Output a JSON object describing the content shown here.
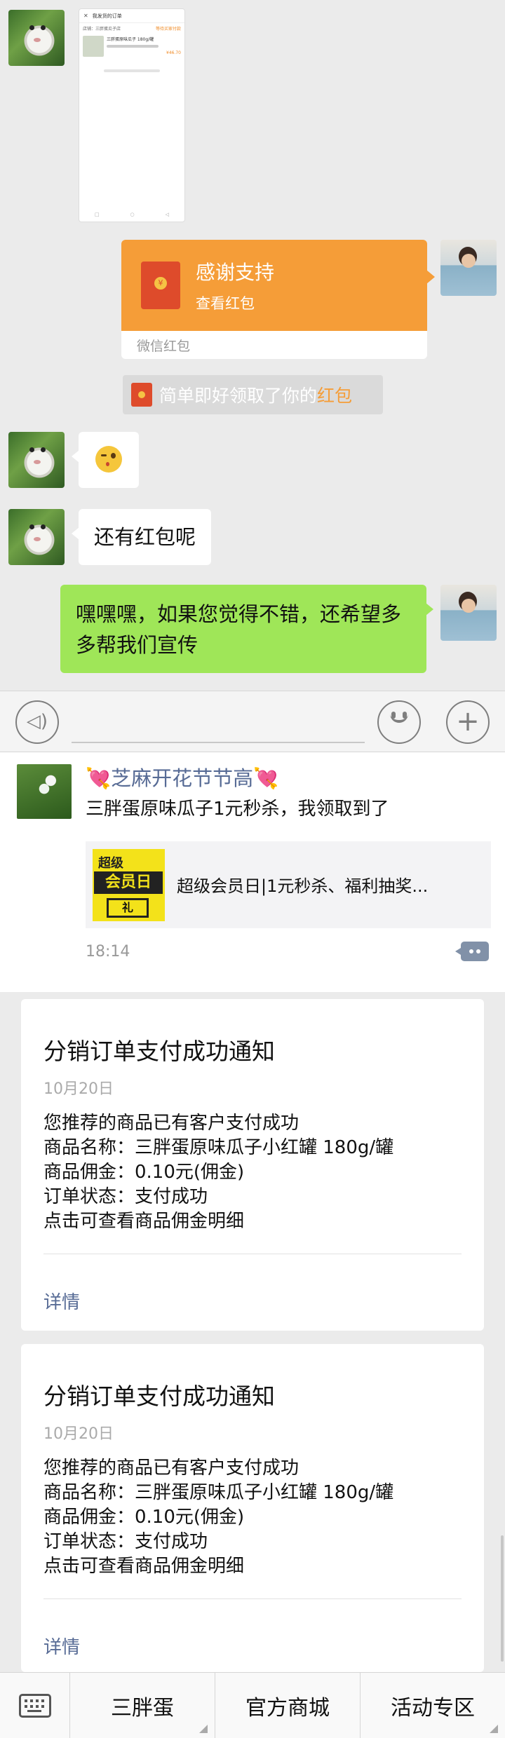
{
  "chat": {
    "screenshot": {
      "title": "我发货的订单",
      "shop": "店铺：三胖蛋瓜子店",
      "status": "等待买家付款",
      "item": "三胖蛋原味瓜子 180g/罐",
      "price": "¥46.70",
      "nav": [
        "□",
        "○",
        "◁"
      ]
    },
    "red_packet": {
      "title": "感谢支持",
      "subtitle": "查看红包",
      "footer": "微信红包"
    },
    "system_notice": {
      "text": "简单即好领取了你的",
      "link": "红包"
    },
    "msg_reply": "还有红包呢",
    "msg_green": "嘿嘿嘿，如果您觉得不错，还希望多多帮我们宣传"
  },
  "input_bar": {
    "voice_icon": "voice-icon",
    "emoji_icon": "smiley-icon",
    "plus_icon": "plus-icon"
  },
  "moment": {
    "name_prefix": "💘",
    "name": "芝麻开花节节高",
    "name_suffix": "💘",
    "text": "三胖蛋原味瓜子1元秒杀，我领取到了",
    "link_title": "超级会员日|1元秒杀、福利抽奖...",
    "thumb_line1": "超级",
    "thumb_line2": "会员日",
    "thumb_line3": "礼",
    "time": "18:14"
  },
  "notices": [
    {
      "title": "分销订单支付成功通知",
      "date": "10月20日",
      "lines": [
        "您推荐的商品已有客户支付成功",
        "商品名称：三胖蛋原味瓜子小红罐 180g/罐",
        "商品佣金：0.10元(佣金)",
        "订单状态：支付成功",
        "点击可查看商品佣金明细"
      ],
      "detail": "详情"
    },
    {
      "title": "分销订单支付成功通知",
      "date": "10月20日",
      "lines": [
        "您推荐的商品已有客户支付成功",
        "商品名称：三胖蛋原味瓜子小红罐 180g/罐",
        "商品佣金：0.10元(佣金)",
        "订单状态：支付成功",
        "点击可查看商品佣金明细"
      ],
      "detail": "详情"
    }
  ],
  "bottom_menu": {
    "items": [
      "三胖蛋",
      "官方商城",
      "活动专区"
    ]
  },
  "colors": {
    "red_packet": "#f59d38",
    "bubble_green": "#9fe658",
    "link_blue": "#576b95"
  }
}
